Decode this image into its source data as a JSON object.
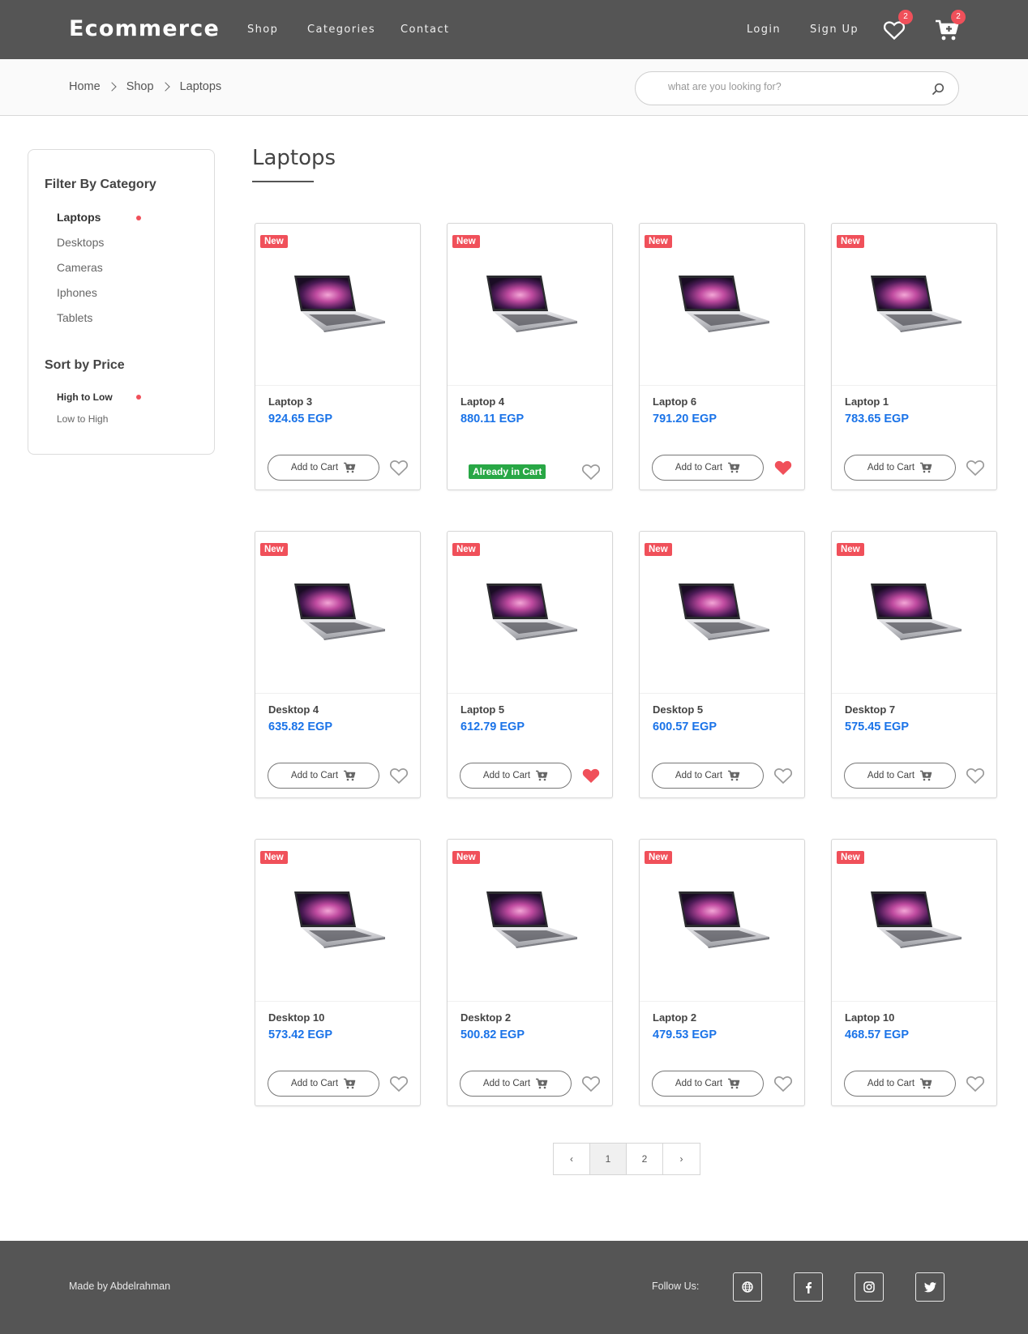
{
  "header": {
    "brand": "Ecommerce",
    "nav": [
      "Shop",
      "Categories",
      "Contact"
    ],
    "login": "Login",
    "signup": "Sign Up",
    "wishlist_count": "2",
    "cart_count": "2"
  },
  "breadcrumb": [
    "Home",
    "Shop",
    "Laptops"
  ],
  "search": {
    "placeholder": "what are you looking for?"
  },
  "sidebar": {
    "filter_title": "Filter By Category",
    "categories": [
      "Laptops",
      "Desktops",
      "Cameras",
      "Iphones",
      "Tablets"
    ],
    "sort_title": "Sort by Price",
    "sort_options": [
      "High to Low",
      "Low to High"
    ]
  },
  "main": {
    "title": "Laptops"
  },
  "labels": {
    "new_badge": "New",
    "add_to_cart": "Add to Cart",
    "already_in_cart": "Already in Cart"
  },
  "products": [
    {
      "name": "Laptop 3",
      "price": "924.65 EGP",
      "in_cart": false,
      "favorited": false
    },
    {
      "name": "Laptop 4",
      "price": "880.11 EGP",
      "in_cart": true,
      "favorited": false
    },
    {
      "name": "Laptop 6",
      "price": "791.20 EGP",
      "in_cart": false,
      "favorited": true
    },
    {
      "name": "Laptop 1",
      "price": "783.65 EGP",
      "in_cart": false,
      "favorited": false
    },
    {
      "name": "Desktop 4",
      "price": "635.82 EGP",
      "in_cart": false,
      "favorited": false
    },
    {
      "name": "Laptop 5",
      "price": "612.79 EGP",
      "in_cart": false,
      "favorited": true
    },
    {
      "name": "Desktop 5",
      "price": "600.57 EGP",
      "in_cart": false,
      "favorited": false
    },
    {
      "name": "Desktop 7",
      "price": "575.45 EGP",
      "in_cart": false,
      "favorited": false
    },
    {
      "name": "Desktop 10",
      "price": "573.42 EGP",
      "in_cart": false,
      "favorited": false
    },
    {
      "name": "Desktop 2",
      "price": "500.82 EGP",
      "in_cart": false,
      "favorited": false
    },
    {
      "name": "Laptop 2",
      "price": "479.53 EGP",
      "in_cart": false,
      "favorited": false
    },
    {
      "name": "Laptop 10",
      "price": "468.57 EGP",
      "in_cart": false,
      "favorited": false
    }
  ],
  "pagination": {
    "prev": "‹",
    "pages": [
      "1",
      "2"
    ],
    "next": "›",
    "current": "1"
  },
  "footer": {
    "made_by": "Made by Abdelrahman",
    "follow": "Follow Us:",
    "socials": [
      "globe-icon",
      "facebook-icon",
      "instagram-icon",
      "twitter-icon"
    ]
  },
  "colors": {
    "header_bg": "#555555",
    "accent_red": "#f0505a",
    "price_blue": "#1a73e8",
    "in_cart_green": "#28a745"
  }
}
